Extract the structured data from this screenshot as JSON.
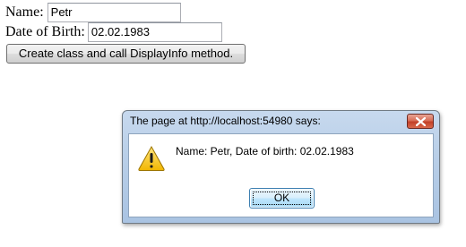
{
  "form": {
    "name_label": "Name:",
    "name_value": "Petr",
    "dob_label": "Date of Birth:",
    "dob_value": "02.02.1983",
    "create_button_label": "Create class and call DisplayInfo method."
  },
  "dialog": {
    "title": "The page at http://localhost:54980 says:",
    "message": "Name: Petr, Date of birth: 02.02.1983",
    "ok_label": "OK",
    "icon": "warning-icon",
    "close_icon": "close-icon"
  },
  "colors": {
    "dialog_frame": "#b9cfe8",
    "close_button": "#c24128",
    "warning_fill": "#f5c400"
  }
}
